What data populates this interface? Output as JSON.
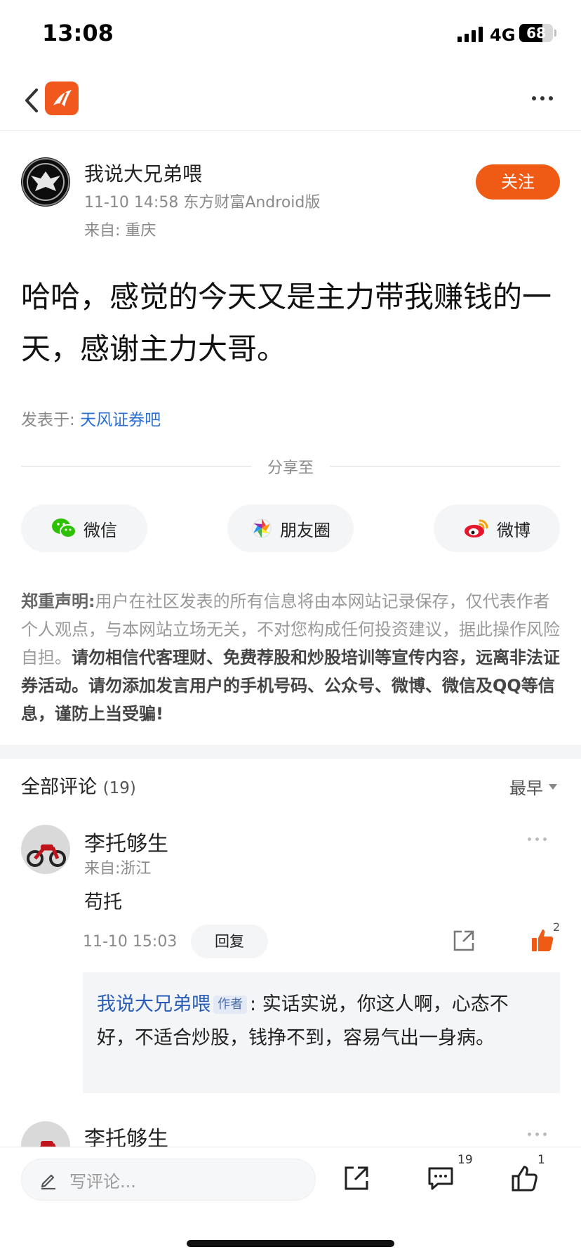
{
  "status_bar": {
    "time": "13:08",
    "network": "4G",
    "battery": "68",
    "battery_level": 0.68
  },
  "post": {
    "author": "我说大兄弟喂",
    "meta": "11-10 14:58 东方财富Android版",
    "location": "来自: 重庆",
    "follow_label": "关注",
    "content": "哈哈，感觉的今天又是主力带我赚钱的一天，感谢主力大哥。",
    "posted_in_label": "发表于:",
    "posted_in_forum": "天风证券吧"
  },
  "share": {
    "label": "分享至",
    "wechat": "微信",
    "moments": "朋友圈",
    "weibo": "微博"
  },
  "disclaimer": {
    "title": "郑重声明:",
    "text": "用户在社区发表的所有信息将由本网站记录保存，仅代表作者个人观点，与本网站立场无关，不对您构成任何投资建议，据此操作风险自担。",
    "warning": "请勿相信代客理财、免费荐股和炒股培训等宣传内容，远离非法证券活动。请勿添加发言用户的手机号码、公众号、微博、微信及QQ等信息，谨防上当受骗!"
  },
  "comments": {
    "header": "全部评论",
    "count": "(19)",
    "sort": "最早",
    "items": [
      {
        "name": "李托够生",
        "location": "来自:浙江",
        "text": "苟托",
        "time": "11-10 15:03",
        "reply_label": "回复",
        "likes": "2",
        "reply": {
          "author": "我说大兄弟喂",
          "tag": "作者",
          "separator": ":",
          "text": "实话实说，你这人啊，心态不好，不适合炒股，钱挣不到，容易气出一身病。"
        }
      },
      {
        "name": "李托够生"
      }
    ]
  },
  "bottom_bar": {
    "placeholder": "写评论...",
    "comment_count": "19",
    "like_count": "1"
  },
  "colors": {
    "accent": "#ef5a14",
    "link": "#2a6fd6",
    "muted": "#8a8a8a"
  }
}
